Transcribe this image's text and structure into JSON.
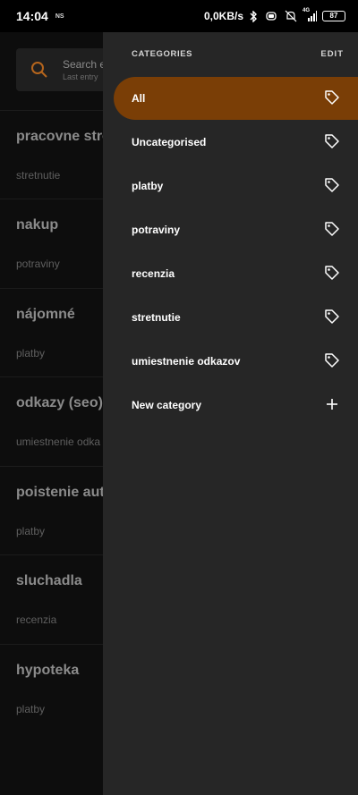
{
  "status_bar": {
    "time": "14:04",
    "ns_label": "NS",
    "speed": "0,0KB/s",
    "network": "4G",
    "battery": "87"
  },
  "search": {
    "placeholder": "Search e",
    "subtitle": "Last entry"
  },
  "entries": [
    {
      "title": "pracovne stre",
      "category": "stretnutie"
    },
    {
      "title": "nakup",
      "category": "potraviny"
    },
    {
      "title": "nájomné",
      "category": "platby"
    },
    {
      "title": "odkazy (seo)",
      "category": "umiestnenie odka"
    },
    {
      "title": "poistenie auta",
      "category": "platby"
    },
    {
      "title": "sluchadla",
      "category": "recenzia"
    },
    {
      "title": "hypoteka",
      "category": "platby"
    }
  ],
  "drawer": {
    "header": "CATEGORIES",
    "edit": "EDIT",
    "categories": [
      {
        "label": "All",
        "icon": "tag-icon",
        "active": true
      },
      {
        "label": "Uncategorised",
        "icon": "tag-icon"
      },
      {
        "label": "platby",
        "icon": "tag-icon"
      },
      {
        "label": "potraviny",
        "icon": "tag-icon"
      },
      {
        "label": "recenzia",
        "icon": "tag-icon"
      },
      {
        "label": "stretnutie",
        "icon": "tag-icon"
      },
      {
        "label": "umiestnenie odkazov",
        "icon": "tag-icon"
      }
    ],
    "new_category": {
      "label": "New category",
      "icon": "plus-icon"
    }
  },
  "colors": {
    "accent": "#7a3e06",
    "drawer_bg": "#262626",
    "search_icon": "#b5651d"
  }
}
